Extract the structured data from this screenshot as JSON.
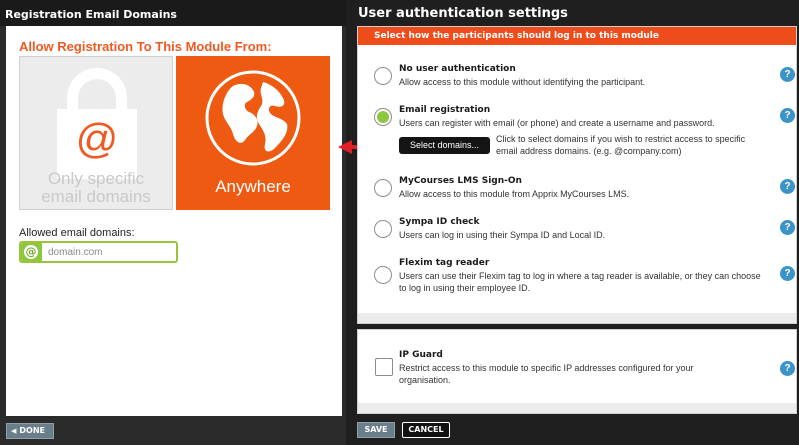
{
  "left_dialog": {
    "title": "Registration Email Domains",
    "heading": "Allow Registration To This Module From:",
    "specific_option": {
      "label_line1": "Only specific",
      "label_line2": "email domains",
      "icon": "lock-at-icon"
    },
    "anywhere_option": {
      "label": "Anywhere",
      "icon": "globe-icon"
    },
    "allowed_label": "Allowed email domains:",
    "domain_input": {
      "value": "",
      "placeholder": "domain.com"
    },
    "done_label": "DONE"
  },
  "right_panel": {
    "title": "User authentication settings",
    "header": "Select how the participants should log in to this module",
    "options": [
      {
        "title": "No user authentication",
        "description": "Allow access to this module without identifying the participant.",
        "selected": false
      },
      {
        "title": "Email registration",
        "description": "Users can register with email (or phone) and create a username and password.",
        "selected": true
      },
      {
        "title": "MyCourses LMS Sign-On",
        "description": "Allow access to this module from Apprix MyCourses LMS.",
        "selected": false
      },
      {
        "title": "Sympa ID check",
        "description": "Users can log in using their Sympa ID and Local ID.",
        "selected": false
      },
      {
        "title": "Flexim tag reader",
        "description": "Users can use their Flexim tag to log in where a tag reader is available, or they can choose to log in using their employee ID.",
        "selected": false
      }
    ],
    "select_domains_label": "Select domains...",
    "select_domains_help": "Click to select domains if you wish to restrict access to specific email address domains. (e.g. @company.com)",
    "ip_guard": {
      "title": "IP Guard",
      "description": "Restrict access to this module to specific IP addresses configured for your organisation.",
      "checked": false
    },
    "help_glyph": "?",
    "save_label": "SAVE",
    "cancel_label": "CANCEL"
  },
  "colors": {
    "accent": "#ee4c1a",
    "selected": "#8dc63f",
    "help": "#3b93c9"
  }
}
